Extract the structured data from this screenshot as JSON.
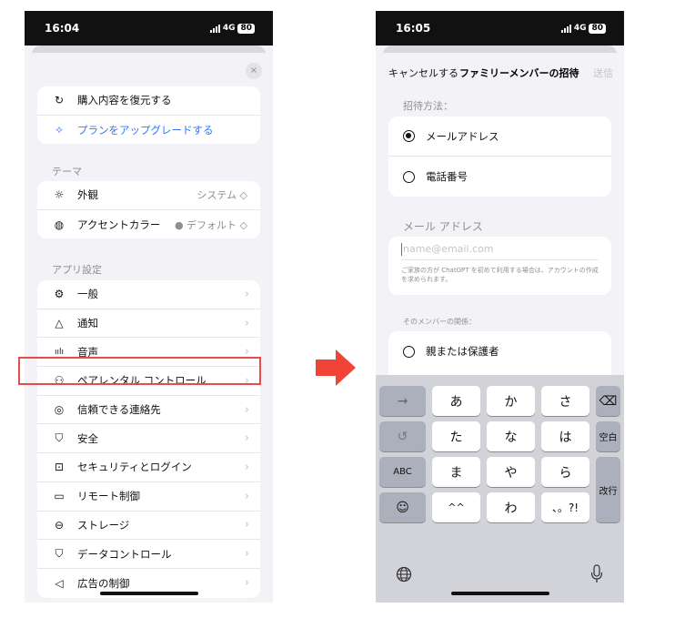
{
  "left": {
    "time": "16:04",
    "network": "4G",
    "battery": "80",
    "close": "×",
    "account_items": [
      {
        "icon": "restore-icon",
        "glyph": "↻",
        "label": "購入内容を復元する"
      },
      {
        "icon": "sparkle-icon",
        "glyph": "✧",
        "label": "プランをアップグレードする"
      }
    ],
    "theme_header": "テーマ",
    "theme_items": [
      {
        "icon": "sun-icon",
        "glyph": "☼",
        "label": "外観",
        "value": "システム ◇"
      },
      {
        "icon": "palette-icon",
        "glyph": "◍",
        "label": "アクセントカラー",
        "value": "● デフォルト ◇"
      }
    ],
    "app_header": "アプリ設定",
    "app_items": [
      {
        "icon": "gear-icon",
        "glyph": "⚙",
        "label": "一般"
      },
      {
        "icon": "bell-icon",
        "glyph": "△",
        "label": "通知"
      },
      {
        "icon": "waveform-icon",
        "glyph": "ıılı",
        "label": "音声"
      },
      {
        "icon": "people-icon",
        "glyph": "⚇",
        "label": "ペアレンタル コントロール"
      },
      {
        "icon": "lifebuoy-icon",
        "glyph": "◎",
        "label": "信頼できる連絡先"
      },
      {
        "icon": "shield-icon",
        "glyph": "⛉",
        "label": "安全"
      },
      {
        "icon": "lock-icon",
        "glyph": "⊡",
        "label": "セキュリティとログイン"
      },
      {
        "icon": "monitor-icon",
        "glyph": "▭",
        "label": "リモート制御"
      },
      {
        "icon": "storage-icon",
        "glyph": "⊖",
        "label": "ストレージ"
      },
      {
        "icon": "data-shield-icon",
        "glyph": "⛉",
        "label": "データコントロール"
      },
      {
        "icon": "megaphone-icon",
        "glyph": "◁",
        "label": "広告の制御"
      }
    ]
  },
  "right": {
    "time": "16:05",
    "network": "4G",
    "battery": "80",
    "cancel": "キャンセルする",
    "title": "ファミリーメンバーの招待",
    "send": "送信",
    "method_header": "招待方法：",
    "options": [
      "メールアドレス",
      "電話番号"
    ],
    "email_header": "メール アドレス",
    "email_placeholder": "name@email.com",
    "email_note": "ご家族の方が ChatGPT を初めて利用する場合は、アカウントの作成を求められます。",
    "relation_header": "そのメンバーの関係：",
    "relation_option": "親または保護者",
    "keyboard": {
      "rows": [
        [
          "→",
          "あ",
          "か",
          "さ",
          "⌫"
        ],
        [
          "↺",
          "た",
          "な",
          "は",
          "空白"
        ],
        [
          "ABC",
          "ま",
          "や",
          "ら",
          "改行"
        ],
        [
          "☺",
          "^^",
          "わ",
          "、。?!"
        ]
      ],
      "globe": "globe-icon",
      "mic": "mic-icon"
    }
  }
}
